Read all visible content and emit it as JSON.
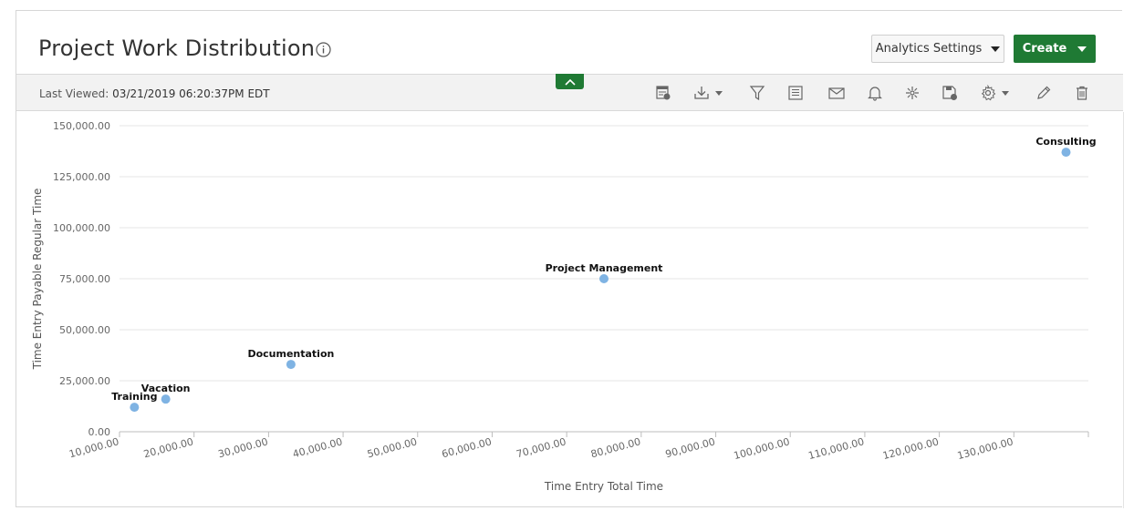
{
  "header": {
    "title": "Project Work Distribution",
    "analytics_settings_label": "Analytics Settings",
    "create_label": "Create"
  },
  "toolbar": {
    "last_viewed_label": "Last Viewed:",
    "last_viewed_value": "03/21/2019 06:20:37PM EDT",
    "icons": [
      "calendar-table-icon",
      "download-icon",
      "filter-icon",
      "report-list-icon",
      "email-icon",
      "bell-icon",
      "integration-icon",
      "save-icon",
      "gear-icon",
      "edit-icon",
      "trash-icon"
    ]
  },
  "colors": {
    "accent_green": "#1f7a34",
    "point_color": "#7fb3e3"
  },
  "chart_data": {
    "type": "scatter",
    "title": "",
    "xlabel": "Time Entry Total Time",
    "ylabel": "Time Entry Payable Regular Time",
    "xlim": [
      10000,
      140000
    ],
    "ylim": [
      0,
      150000
    ],
    "x_ticks": [
      10000,
      20000,
      30000,
      40000,
      50000,
      60000,
      70000,
      80000,
      90000,
      100000,
      110000,
      120000,
      130000
    ],
    "x_tick_labels": [
      "10,000.00",
      "20,000.00",
      "30,000.00",
      "40,000.00",
      "50,000.00",
      "60,000.00",
      "70,000.00",
      "80,000.00",
      "90,000.00",
      "100,000.00",
      "110,000.00",
      "120,000.00",
      "130,000.00"
    ],
    "y_ticks": [
      0,
      25000,
      50000,
      75000,
      100000,
      125000,
      150000
    ],
    "y_tick_labels": [
      "0.00",
      "25,000.00",
      "50,000.00",
      "75,000.00",
      "100,000.00",
      "125,000.00",
      "150,000.00"
    ],
    "grid": true,
    "points": [
      {
        "label": "Training",
        "x": 12000,
        "y": 12000
      },
      {
        "label": "Vacation",
        "x": 16200,
        "y": 16000
      },
      {
        "label": "Documentation",
        "x": 33000,
        "y": 33000
      },
      {
        "label": "Project Management",
        "x": 75000,
        "y": 75000
      },
      {
        "label": "Consulting",
        "x": 137000,
        "y": 137000
      }
    ]
  }
}
